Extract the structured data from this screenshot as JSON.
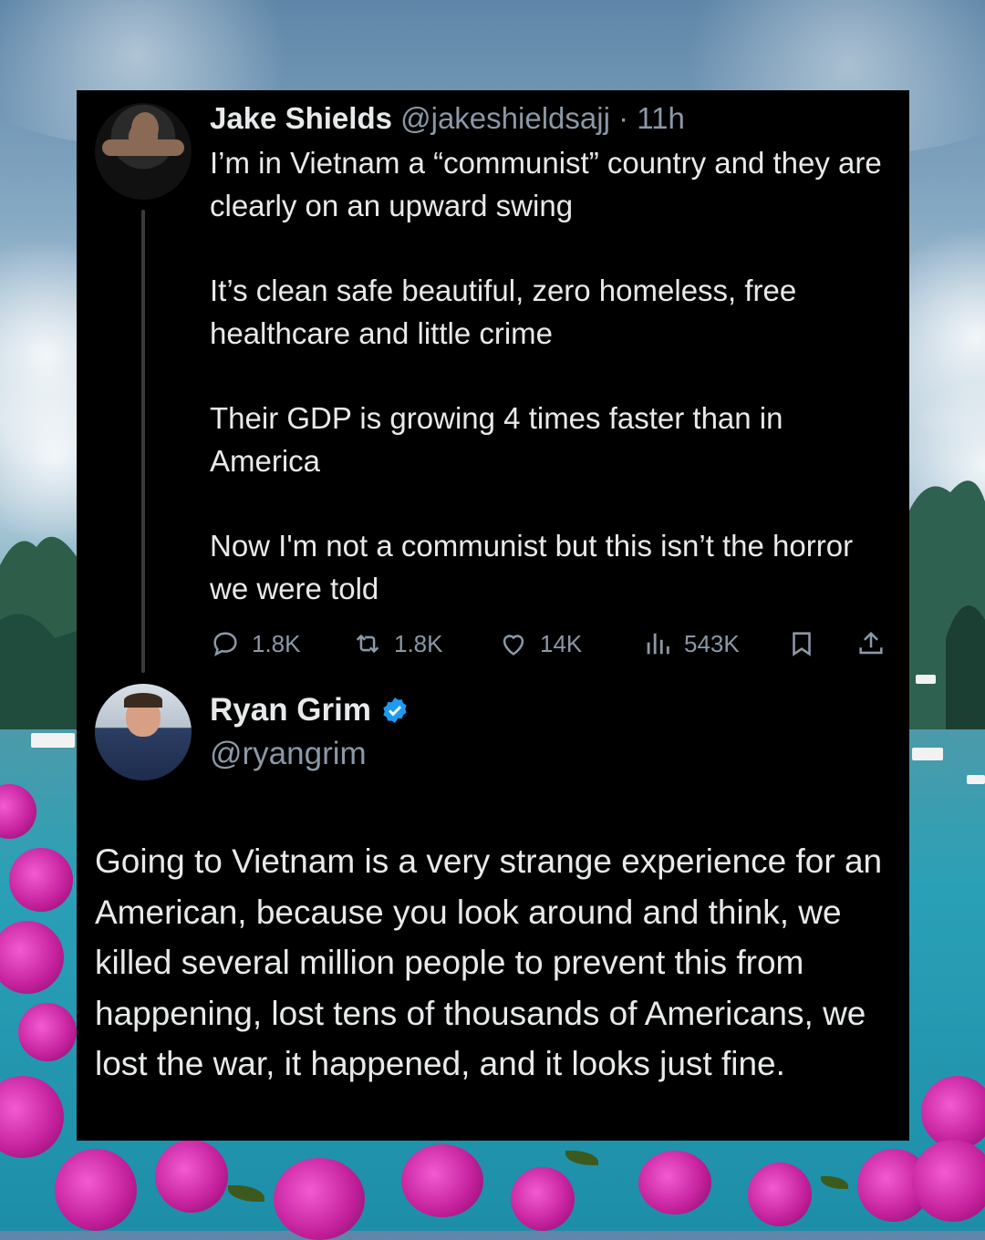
{
  "tweet1": {
    "display_name": "Jake Shields",
    "handle": "@jakeshieldsajj",
    "time": "· 11h",
    "paragraphs": [
      "I’m in Vietnam a “communist” country and they are clearly on an upward swing",
      "It’s clean safe beautiful, zero homeless, free healthcare and little crime",
      "Their GDP is growing 4 times faster than in America",
      "Now I'm not a communist but this isn’t the horror we were told"
    ],
    "stats": {
      "replies": "1.8K",
      "reposts": "1.8K",
      "likes": "14K",
      "views": "543K"
    }
  },
  "tweet2": {
    "display_name": "Ryan Grim",
    "handle": "@ryangrim",
    "verified_color": "#1d9bf0",
    "text": "Going to Vietnam is a very strange experience for an American, because you look around and think, we killed several million people to prevent this from happening, lost tens of thousands of Americans, we lost the war, it happened, and it looks just fine."
  },
  "icons": {
    "reply": "reply-icon",
    "repost": "repost-icon",
    "like": "heart-icon",
    "views": "views-icon",
    "bookmark": "bookmark-icon",
    "share": "share-icon",
    "verified": "verified-badge-icon"
  },
  "colors": {
    "card_bg": "#000000",
    "text": "#e7e9ea",
    "muted": "#8b98a5"
  }
}
